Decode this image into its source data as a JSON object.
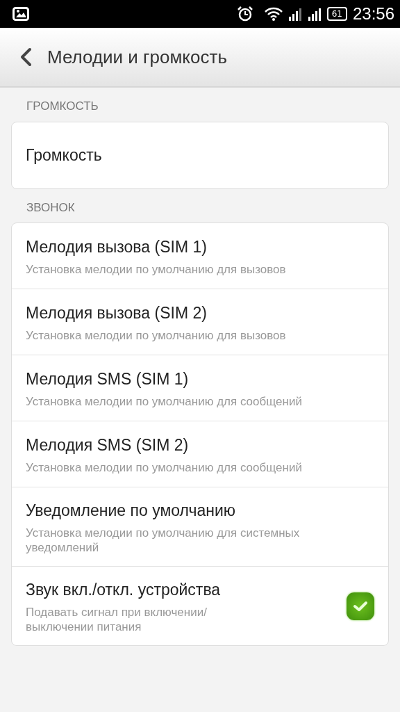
{
  "status_bar": {
    "battery": "61",
    "time": "23:56"
  },
  "header": {
    "title": "Мелодии и громкость"
  },
  "sections": [
    {
      "title": "ГРОМКОСТЬ",
      "items": [
        {
          "kind": "plain",
          "title": "Громкость"
        }
      ]
    },
    {
      "title": "ЗВОНОК",
      "items": [
        {
          "kind": "plain",
          "title": "Мелодия вызова (SIM 1)",
          "subtitle": "Установка мелодии по умолчанию для вызовов"
        },
        {
          "kind": "plain",
          "title": "Мелодия вызова (SIM 2)",
          "subtitle": "Установка мелодии по умолчанию для вызовов"
        },
        {
          "kind": "plain",
          "title": "Мелодия SMS (SIM 1)",
          "subtitle": "Установка мелодии по умолчанию для сообщений"
        },
        {
          "kind": "plain",
          "title": "Мелодия SMS (SIM 2)",
          "subtitle": "Установка мелодии по умолчанию для сообщений"
        },
        {
          "kind": "plain",
          "title": "Уведомление по умолчанию",
          "subtitle": "Установка мелодии по умолчанию для системных уведомлений"
        },
        {
          "kind": "checkbox",
          "title": "Звук вкл./откл. устройства",
          "subtitle": "Подавать сигнал при включении/ выключении питания",
          "checked": true
        }
      ]
    }
  ]
}
